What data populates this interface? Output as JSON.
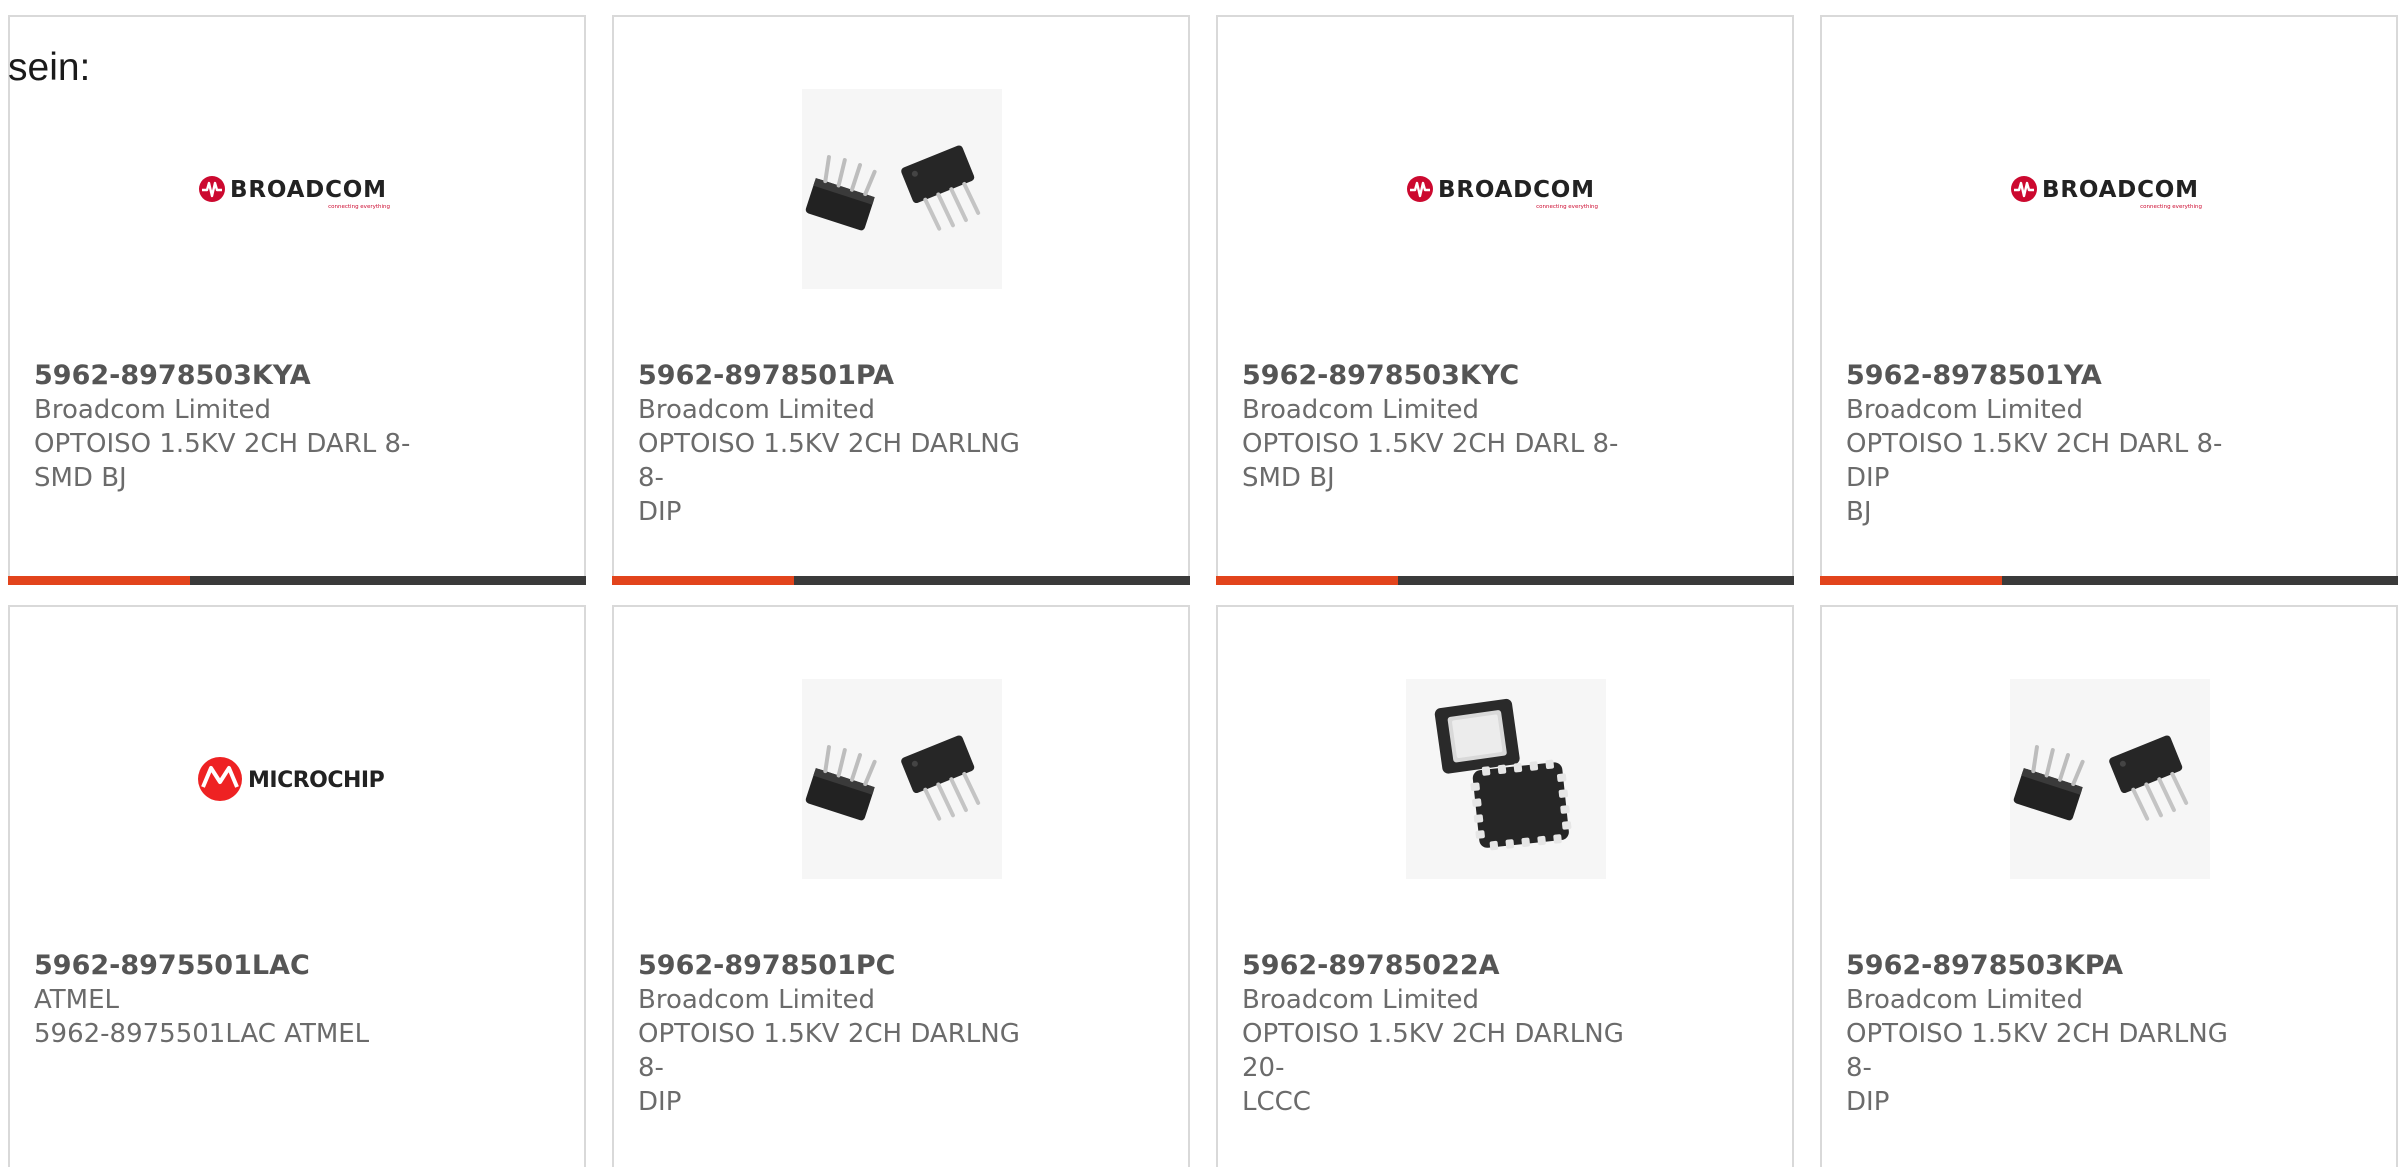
{
  "intro_text": "sein:",
  "colors": {
    "accent": "#e2441c",
    "bar": "#3a3a3a",
    "border": "#d9d9d9",
    "broadcom_red": "#cc092f",
    "microchip_red": "#ee2223"
  },
  "logos": {
    "broadcom": {
      "name": "BROADCOM",
      "tagline": "connecting everything"
    },
    "microchip": {
      "name": "MICROCHIP"
    }
  },
  "products": [
    {
      "part_number": "5962-8978503KYA",
      "manufacturer": "Broadcom Limited",
      "description": "OPTOISO 1.5KV 2CH DARL 8-SMD BJ",
      "description_lines": [
        "OPTOISO 1.5KV 2CH DARL 8-",
        "SMD BJ"
      ],
      "image": "broadcom-logo",
      "show_bar": true
    },
    {
      "part_number": "5962-8978501PA",
      "manufacturer": "Broadcom Limited",
      "description": "OPTOISO 1.5KV 2CH DARLNG 8-DIP",
      "description_lines": [
        "OPTOISO 1.5KV 2CH DARLNG 8-",
        "DIP"
      ],
      "image": "dip-package-icon",
      "show_bar": true
    },
    {
      "part_number": "5962-8978503KYC",
      "manufacturer": "Broadcom Limited",
      "description": "OPTOISO 1.5KV 2CH DARL 8-SMD BJ",
      "description_lines": [
        "OPTOISO 1.5KV 2CH DARL 8-",
        "SMD BJ"
      ],
      "image": "broadcom-logo",
      "show_bar": true
    },
    {
      "part_number": "5962-8978501YA",
      "manufacturer": "Broadcom Limited",
      "description": "OPTOISO 1.5KV 2CH DARL 8-DIP BJ",
      "description_lines": [
        "OPTOISO 1.5KV 2CH DARL 8-DIP",
        "BJ"
      ],
      "image": "broadcom-logo",
      "show_bar": true
    },
    {
      "part_number": "5962-8975501LAC",
      "manufacturer": "ATMEL",
      "description": "5962-8975501LAC ATMEL",
      "description_lines": [
        "5962-8975501LAC ATMEL"
      ],
      "image": "microchip-logo",
      "show_bar": false
    },
    {
      "part_number": "5962-8978501PC",
      "manufacturer": "Broadcom Limited",
      "description": "OPTOISO 1.5KV 2CH DARLNG 8-DIP",
      "description_lines": [
        "OPTOISO 1.5KV 2CH DARLNG 8-",
        "DIP"
      ],
      "image": "dip-package-icon",
      "show_bar": false
    },
    {
      "part_number": "5962-89785022A",
      "manufacturer": "Broadcom Limited",
      "description": "OPTOISO 1.5KV 2CH DARLNG 20-LCCC",
      "description_lines": [
        "OPTOISO 1.5KV 2CH DARLNG 20-",
        "LCCC"
      ],
      "image": "lccc-package-icon",
      "show_bar": false
    },
    {
      "part_number": "5962-8978503KPA",
      "manufacturer": "Broadcom Limited",
      "description": "OPTOISO 1.5KV 2CH DARLNG 8-DIP",
      "description_lines": [
        "OPTOISO 1.5KV 2CH DARLNG 8-",
        "DIP"
      ],
      "image": "dip-package-icon",
      "show_bar": false
    }
  ]
}
